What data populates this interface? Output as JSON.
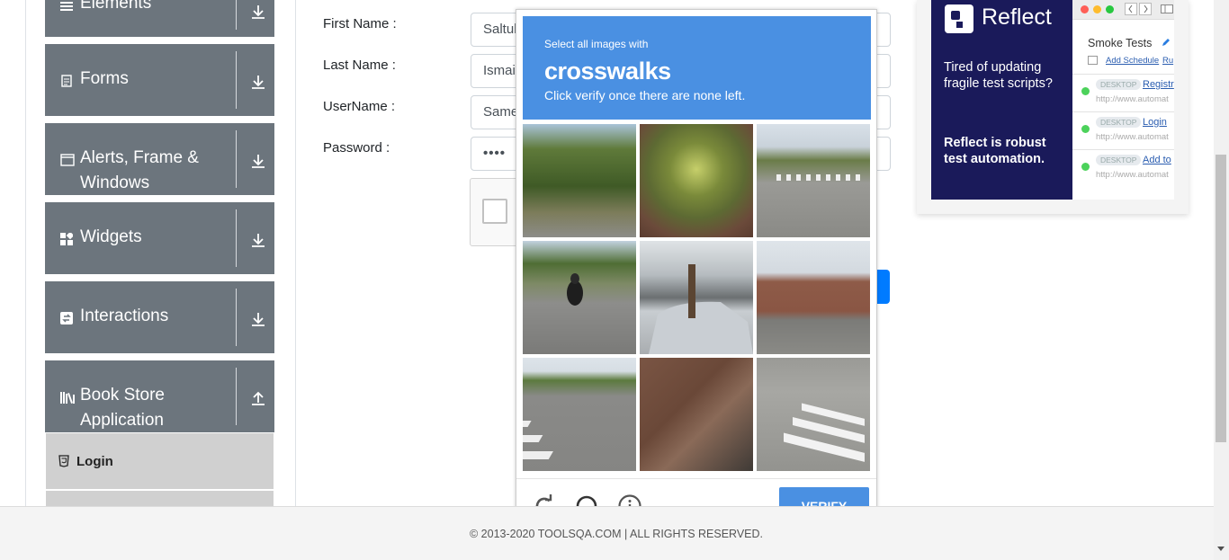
{
  "sidebar": {
    "groups": [
      {
        "label": "Elements",
        "icon": "list-icon",
        "arrow": "down"
      },
      {
        "label": "Forms",
        "icon": "document-icon",
        "arrow": "down"
      },
      {
        "label_line1": "Alerts, Frame &",
        "label_line2": "Windows",
        "icon": "window-icon",
        "arrow": "down"
      },
      {
        "label": "Widgets",
        "icon": "widgets-icon",
        "arrow": "down"
      },
      {
        "label": "Interactions",
        "icon": "interactions-icon",
        "arrow": "down"
      },
      {
        "label_line1": "Book Store",
        "label_line2": "Application",
        "icon": "books-icon",
        "arrow": "up"
      }
    ],
    "sub_items": [
      {
        "label": "Login",
        "icon": "html-icon"
      }
    ]
  },
  "form": {
    "first_name_label": "First Name :",
    "first_name_value": "Saltuk",
    "last_name_label": "Last Name :",
    "last_name_value": "Ismail",
    "username_label": "UserName :",
    "username_value": "Same",
    "password_label": "Password :",
    "password_value": "••••"
  },
  "captcha": {
    "prompt_small": "Select all images with",
    "prompt_big": "crosswalks",
    "instruction": "Click verify once there are none left.",
    "verify_label": "VERIFY",
    "icons": [
      "reload-icon",
      "headphones-icon",
      "info-icon"
    ]
  },
  "ad": {
    "brand": "Reflect",
    "text1": "Tired of updating fragile test scripts?",
    "text2": "Reflect is robust test automation.",
    "smoke_title": "Smoke Tests",
    "add_schedule": "Add Schedule",
    "run": "Ru",
    "rows": [
      {
        "pill": "DESKTOP",
        "link": "Registr",
        "url": "http://www.automat"
      },
      {
        "pill": "DESKTOP",
        "link": "Login",
        "url": "http://www.automat"
      },
      {
        "pill": "DESKTOP",
        "link": "Add to",
        "url": "http://www.automat"
      }
    ]
  },
  "footer": {
    "text": "© 2013-2020 TOOLSQA.COM | ALL RIGHTS RESERVED."
  },
  "colors": {
    "sidebar_group": "#6c757d",
    "captcha_blue": "#4a90e2",
    "primary": "#007bff",
    "ad_navy": "#1a1a5a"
  }
}
